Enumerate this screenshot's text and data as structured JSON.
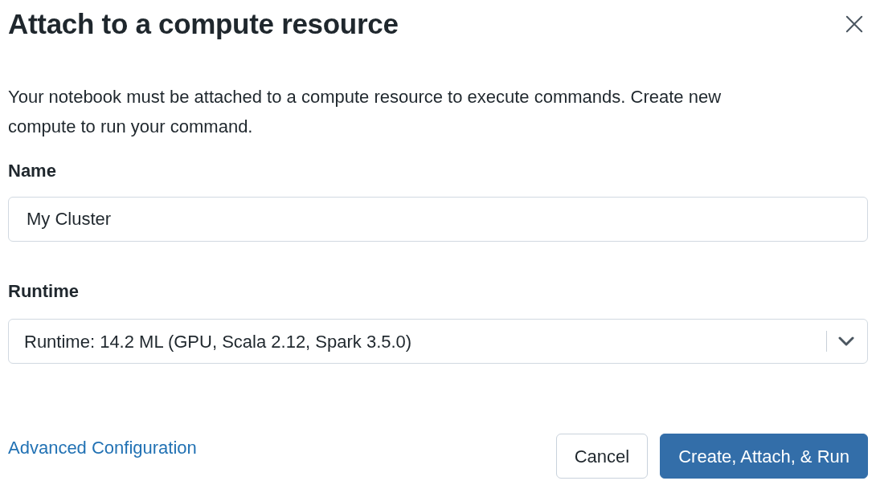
{
  "dialog": {
    "title": "Attach to a compute resource",
    "description": "Your notebook must be attached to a compute resource to execute commands. Create new compute to run your command.",
    "fields": [
      {
        "kind": "text",
        "label": "Name",
        "value": "My Cluster"
      },
      {
        "kind": "select",
        "label": "Runtime",
        "value": "Runtime: 14.2 ML (GPU, Scala 2.12, Spark 3.5.0)"
      }
    ],
    "link": "Advanced Configuration",
    "buttons": [
      {
        "kind": "secondary",
        "label": "Cancel"
      },
      {
        "kind": "primary",
        "label": "Create, Attach, & Run"
      }
    ]
  }
}
